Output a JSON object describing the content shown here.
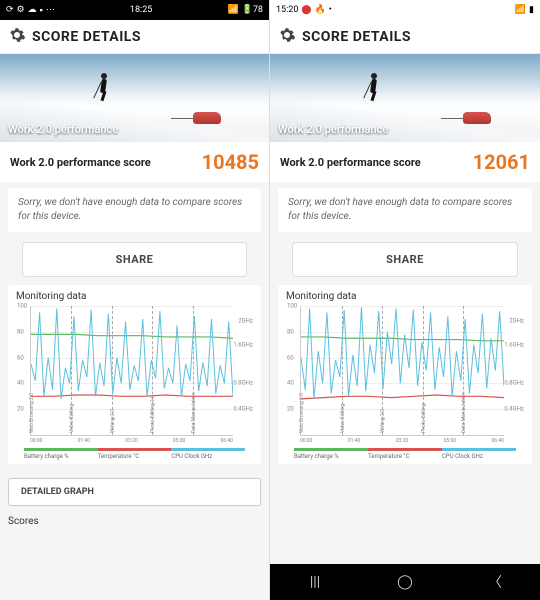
{
  "left": {
    "status": {
      "time": "18:25",
      "battery": "78"
    },
    "header": "SCORE DETAILS",
    "hero_label": "Work 2.0 performance",
    "score_label": "Work 2.0 performance score",
    "score": "10485",
    "message": "Sorry, we don't have enough data to compare scores for this device.",
    "share": "SHARE",
    "mon_title": "Monitoring data",
    "detail_btn": "DETAILED GRAPH",
    "scores_hdr": "Scores"
  },
  "right": {
    "status": {
      "time": "15:20"
    },
    "header": "SCORE DETAILS",
    "hero_label": "Work 2.0 performance",
    "score_label": "Work 2.0 performance score",
    "score": "12061",
    "message": "Sorry, we don't have enough data to compare scores for this device.",
    "share": "SHARE",
    "mon_title": "Monitoring data"
  },
  "legend": {
    "a": "Battery charge %",
    "b": "Temperature °C",
    "c": "CPU Clock GHz"
  },
  "chart_data": [
    {
      "type": "line",
      "title": "Monitoring data",
      "xlabel": "",
      "ylabel": "",
      "x_ticks": [
        "00:00",
        "01:40",
        "03:20",
        "05:00",
        "06:40"
      ],
      "y_left_ticks": [
        20,
        40,
        60,
        80,
        100
      ],
      "y_right_ticks": [
        "0.4GHz",
        "0.8GHz",
        "1.6GHz",
        "2GHz"
      ],
      "sections": [
        "Web Browsing 2.0",
        "Video Editing",
        "Writing 2.0",
        "Photo Editing 2.0",
        "Data Manipulation"
      ],
      "series": [
        {
          "name": "Battery charge %",
          "color": "#5cb85c",
          "values_pct": [
            78,
            78,
            78,
            77,
            77,
            77,
            76,
            76,
            76,
            75
          ]
        },
        {
          "name": "Temperature °C",
          "color": "#d9534f",
          "values_pct": [
            30,
            30,
            31,
            31,
            30,
            30,
            31,
            30,
            30,
            30
          ]
        },
        {
          "name": "CPU Clock GHz",
          "color": "#5bc0de",
          "values_pct": [
            55,
            42,
            95,
            30,
            60,
            35,
            98,
            28,
            52,
            40,
            92,
            34,
            58,
            45,
            97,
            30,
            56,
            38,
            94,
            32,
            60,
            40,
            88,
            35,
            54,
            42,
            90,
            30,
            58,
            44,
            96,
            36,
            52,
            40,
            85,
            30,
            55,
            42,
            92,
            34,
            56,
            38,
            90,
            32,
            54,
            40,
            88,
            30
          ]
        }
      ]
    },
    {
      "type": "line",
      "title": "Monitoring data",
      "xlabel": "",
      "ylabel": "",
      "x_ticks": [
        "00:00",
        "01:40",
        "03:20",
        "05:00",
        "06:40"
      ],
      "y_left_ticks": [
        20,
        40,
        60,
        80,
        100
      ],
      "y_right_ticks": [
        "0.4GHz",
        "0.8GHz",
        "1.6GHz",
        "2GHz"
      ],
      "sections": [
        "Web Browsing 2.0",
        "Video Editing",
        "Writing 2.0",
        "Photo Editing",
        "Data Manipulation"
      ],
      "series": [
        {
          "name": "Battery charge %",
          "color": "#5cb85c",
          "values_pct": [
            76,
            76,
            75,
            75,
            75,
            74,
            74,
            74,
            73,
            73
          ]
        },
        {
          "name": "Temperature °C",
          "color": "#d9534f",
          "values_pct": [
            28,
            29,
            30,
            30,
            29,
            30,
            31,
            30,
            30,
            29
          ]
        },
        {
          "name": "CPU Clock GHz",
          "color": "#5bc0de",
          "values_pct": [
            60,
            35,
            98,
            28,
            65,
            40,
            95,
            32,
            58,
            45,
            97,
            30,
            62,
            38,
            99,
            34,
            70,
            48,
            96,
            36,
            80,
            55,
            98,
            40,
            78,
            52,
            97,
            38,
            72,
            50,
            95,
            35,
            68,
            45,
            92,
            30,
            65,
            42,
            90,
            32,
            70,
            48,
            94,
            36,
            75,
            50,
            96,
            38
          ]
        }
      ]
    }
  ]
}
